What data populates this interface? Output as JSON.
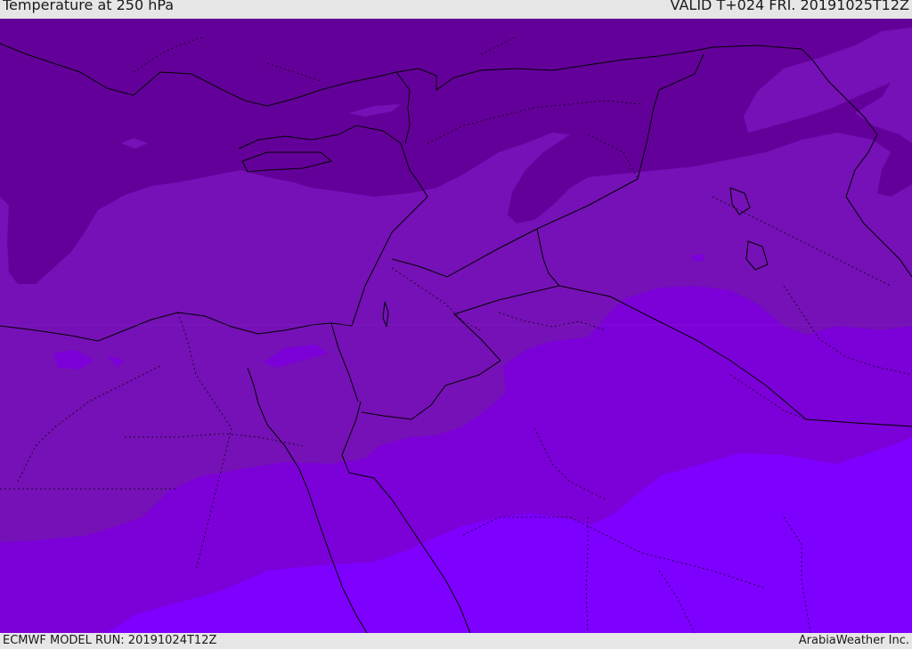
{
  "header": {
    "title": "Temperature at 250 hPa",
    "valid": "VALID T+024 FRI. 20191025T12Z"
  },
  "footer": {
    "model_run": "ECMWF MODEL RUN: 20191024T12Z",
    "credit": "ArabiaWeather Inc."
  },
  "map": {
    "colors": {
      "band_coldest": "#64009a",
      "band_cold": "#7511b6",
      "band_mid": "#7c00d8",
      "band_warm": "#7e00ff",
      "coastline": "#000000",
      "background": "#e6e6e6"
    },
    "icons": [
      "map-icon"
    ]
  }
}
